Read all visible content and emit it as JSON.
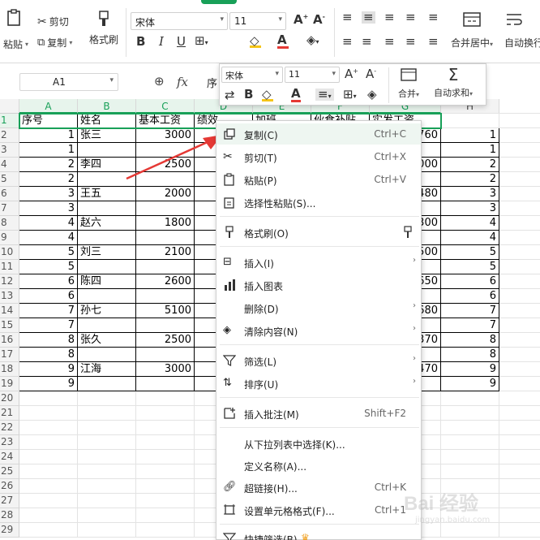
{
  "ribbon": {
    "paste_label": "粘贴",
    "cut_label": "剪切",
    "copy_label": "复制",
    "format_painter_label": "格式刷",
    "font_name": "宋体",
    "font_size": "11",
    "merge_center_label": "合并居中",
    "auto_wrap_label": "自动换行"
  },
  "formula_bar": {
    "name_box": "A1",
    "fx_label": "fx",
    "content": "序"
  },
  "columns": [
    "A",
    "B",
    "C",
    "D",
    "E",
    "F",
    "G",
    "H"
  ],
  "header_cells": [
    "序号",
    "姓名",
    "基本工资",
    "绩效",
    "加班",
    "伙食补贴",
    "实发工资"
  ],
  "rows": [
    {
      "n": "1"
    },
    {
      "n": "2"
    },
    {
      "n": "3"
    },
    {
      "n": "4"
    },
    {
      "n": "5"
    },
    {
      "n": "6"
    },
    {
      "n": "7"
    },
    {
      "n": "8"
    },
    {
      "n": "9"
    },
    {
      "n": "10"
    },
    {
      "n": "11"
    },
    {
      "n": "12"
    },
    {
      "n": "13"
    },
    {
      "n": "14"
    },
    {
      "n": "15"
    },
    {
      "n": "16"
    },
    {
      "n": "17"
    },
    {
      "n": "18"
    },
    {
      "n": "19"
    },
    {
      "n": "20"
    },
    {
      "n": "21"
    },
    {
      "n": "22"
    },
    {
      "n": "23"
    },
    {
      "n": "24"
    },
    {
      "n": "25"
    },
    {
      "n": "26"
    },
    {
      "n": "27"
    },
    {
      "n": "28"
    },
    {
      "n": "29"
    }
  ],
  "table": [
    {
      "a": "1",
      "b": "张三",
      "c": "3000",
      "g": "760",
      "h": "1"
    },
    {
      "a": "1",
      "b": "",
      "c": "",
      "g": "",
      "h": "1"
    },
    {
      "a": "2",
      "b": "李四",
      "c": "2500",
      "g": "000",
      "h": "2"
    },
    {
      "a": "2",
      "b": "",
      "c": "",
      "g": "",
      "h": "2"
    },
    {
      "a": "3",
      "b": "王五",
      "c": "2000",
      "g": "480",
      "h": "3"
    },
    {
      "a": "3",
      "b": "",
      "c": "",
      "g": "",
      "h": "3"
    },
    {
      "a": "4",
      "b": "赵六",
      "c": "1800",
      "g": "300",
      "h": "4"
    },
    {
      "a": "4",
      "b": "",
      "c": "",
      "g": "",
      "h": "4"
    },
    {
      "a": "5",
      "b": "刘三",
      "c": "2100",
      "g": "500",
      "h": "5"
    },
    {
      "a": "5",
      "b": "",
      "c": "",
      "g": "",
      "h": "5"
    },
    {
      "a": "6",
      "b": "陈四",
      "c": "2600",
      "g": "650",
      "h": "6"
    },
    {
      "a": "6",
      "b": "",
      "c": "",
      "g": "",
      "h": "6"
    },
    {
      "a": "7",
      "b": "孙七",
      "c": "5100",
      "g": "680",
      "h": "7"
    },
    {
      "a": "7",
      "b": "",
      "c": "",
      "g": "",
      "h": "7"
    },
    {
      "a": "8",
      "b": "张久",
      "c": "2500",
      "g": "370",
      "h": "8"
    },
    {
      "a": "8",
      "b": "",
      "c": "",
      "g": "",
      "h": "8"
    },
    {
      "a": "9",
      "b": "江海",
      "c": "3000",
      "g": "470",
      "h": "9"
    },
    {
      "a": "9",
      "b": "",
      "c": "",
      "g": "",
      "h": "9"
    }
  ],
  "mini_toolbar": {
    "font_name": "宋体",
    "font_size": "11",
    "merge_label": "合并",
    "autosum_label": "自动求和"
  },
  "context_menu": {
    "copy": {
      "label": "复制(C)",
      "shortcut": "Ctrl+C"
    },
    "cut": {
      "label": "剪切(T)",
      "shortcut": "Ctrl+X"
    },
    "paste": {
      "label": "粘贴(P)",
      "shortcut": "Ctrl+V"
    },
    "paste_special": {
      "label": "选择性粘贴(S)..."
    },
    "format_painter": {
      "label": "格式刷(O)"
    },
    "insert": {
      "label": "插入(I)"
    },
    "insert_chart": {
      "label": "插入图表"
    },
    "delete": {
      "label": "删除(D)"
    },
    "clear": {
      "label": "清除内容(N)"
    },
    "filter": {
      "label": "筛选(L)"
    },
    "sort": {
      "label": "排序(U)"
    },
    "insert_comment": {
      "label": "插入批注(M)",
      "shortcut": "Shift+F2"
    },
    "pick_from_list": {
      "label": "从下拉列表中选择(K)..."
    },
    "define_name": {
      "label": "定义名称(A)..."
    },
    "hyperlink": {
      "label": "超链接(H)...",
      "shortcut": "Ctrl+K"
    },
    "format_cells": {
      "label": "设置单元格格式(F)...",
      "shortcut": "Ctrl+1"
    },
    "quick_filter": {
      "label": "快捷筛选(B)"
    }
  },
  "watermark": {
    "text": "Bai 经验",
    "sub": "jingyan.baidu.com"
  },
  "colors": {
    "accent": "#18a058",
    "arrow": "#e53935",
    "font_color": "#e53935",
    "fill_color": "#f5c518"
  }
}
